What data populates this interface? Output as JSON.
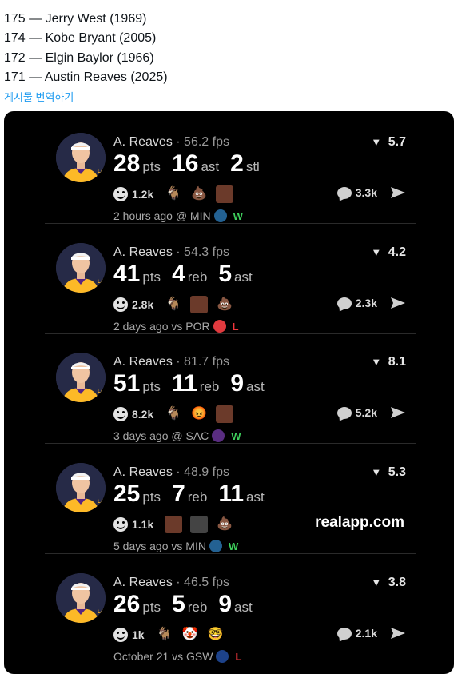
{
  "rank_list": [
    "175 — Jerry West (1969)",
    "174 — Kobe Bryant (2005)",
    "172 — Elgin Baylor (1966)",
    "171 — Austin Reaves (2025)"
  ],
  "translate_label": "게시물 번역하기",
  "posts": [
    {
      "player": "A. Reaves",
      "fps": "56.2 fps",
      "vote": "5.7",
      "stats": [
        {
          "num": "28",
          "unit": "pts"
        },
        {
          "num": "16",
          "unit": "ast"
        },
        {
          "num": "2",
          "unit": "stl"
        }
      ],
      "reactions_count": "1.2k",
      "emojis": [
        "goat-icon",
        "poop-icon",
        "player-face-icon"
      ],
      "comments": "3.3k",
      "meta": "2 hours ago @ MIN",
      "team_logo": "timberwolves-logo",
      "team_color": "#236192",
      "result": "W",
      "result_type": "win"
    },
    {
      "player": "A. Reaves",
      "fps": "54.3 fps",
      "vote": "4.2",
      "stats": [
        {
          "num": "41",
          "unit": "pts"
        },
        {
          "num": "4",
          "unit": "reb"
        },
        {
          "num": "5",
          "unit": "ast"
        }
      ],
      "reactions_count": "2.8k",
      "emojis": [
        "goat-icon",
        "player-face-icon",
        "poop-icon"
      ],
      "comments": "2.3k",
      "meta": "2 days ago vs POR",
      "team_logo": "blazers-logo",
      "team_color": "#e03a3e",
      "result": "L",
      "result_type": "loss"
    },
    {
      "player": "A. Reaves",
      "fps": "81.7 fps",
      "vote": "8.1",
      "stats": [
        {
          "num": "51",
          "unit": "pts"
        },
        {
          "num": "11",
          "unit": "reb"
        },
        {
          "num": "9",
          "unit": "ast"
        }
      ],
      "reactions_count": "8.2k",
      "emojis": [
        "goat-icon",
        "angry-face-icon",
        "player-face-icon"
      ],
      "comments": "5.2k",
      "meta": "3 days ago @ SAC",
      "team_logo": "kings-logo",
      "team_color": "#5a2d81",
      "result": "W",
      "result_type": "win"
    },
    {
      "player": "A. Reaves",
      "fps": "48.9 fps",
      "vote": "5.3",
      "stats": [
        {
          "num": "25",
          "unit": "pts"
        },
        {
          "num": "7",
          "unit": "reb"
        },
        {
          "num": "11",
          "unit": "ast"
        }
      ],
      "reactions_count": "1.1k",
      "emojis": [
        "player-face-icon",
        "referee-icon",
        "poop-icon"
      ],
      "comments": "",
      "watermark": "realapp.com",
      "meta": "5 days ago vs MIN",
      "team_logo": "timberwolves-logo",
      "team_color": "#236192",
      "result": "W",
      "result_type": "win"
    },
    {
      "player": "A. Reaves",
      "fps": "46.5 fps",
      "vote": "3.8",
      "stats": [
        {
          "num": "26",
          "unit": "pts"
        },
        {
          "num": "5",
          "unit": "reb"
        },
        {
          "num": "9",
          "unit": "ast"
        }
      ],
      "reactions_count": "1k",
      "emojis": [
        "goat-icon",
        "clown-icon",
        "nerd-face-icon"
      ],
      "comments": "2.1k",
      "meta": "October 21 vs GSW",
      "team_logo": "warriors-logo",
      "team_color": "#1d428a",
      "result": "L",
      "result_type": "loss"
    }
  ],
  "colors": {
    "card_background": "#000000",
    "link": "#1d9bf0",
    "win": "#3ecf5c",
    "loss": "#f0363c",
    "lakers_purple": "#552583",
    "lakers_gold": "#fdb927"
  }
}
